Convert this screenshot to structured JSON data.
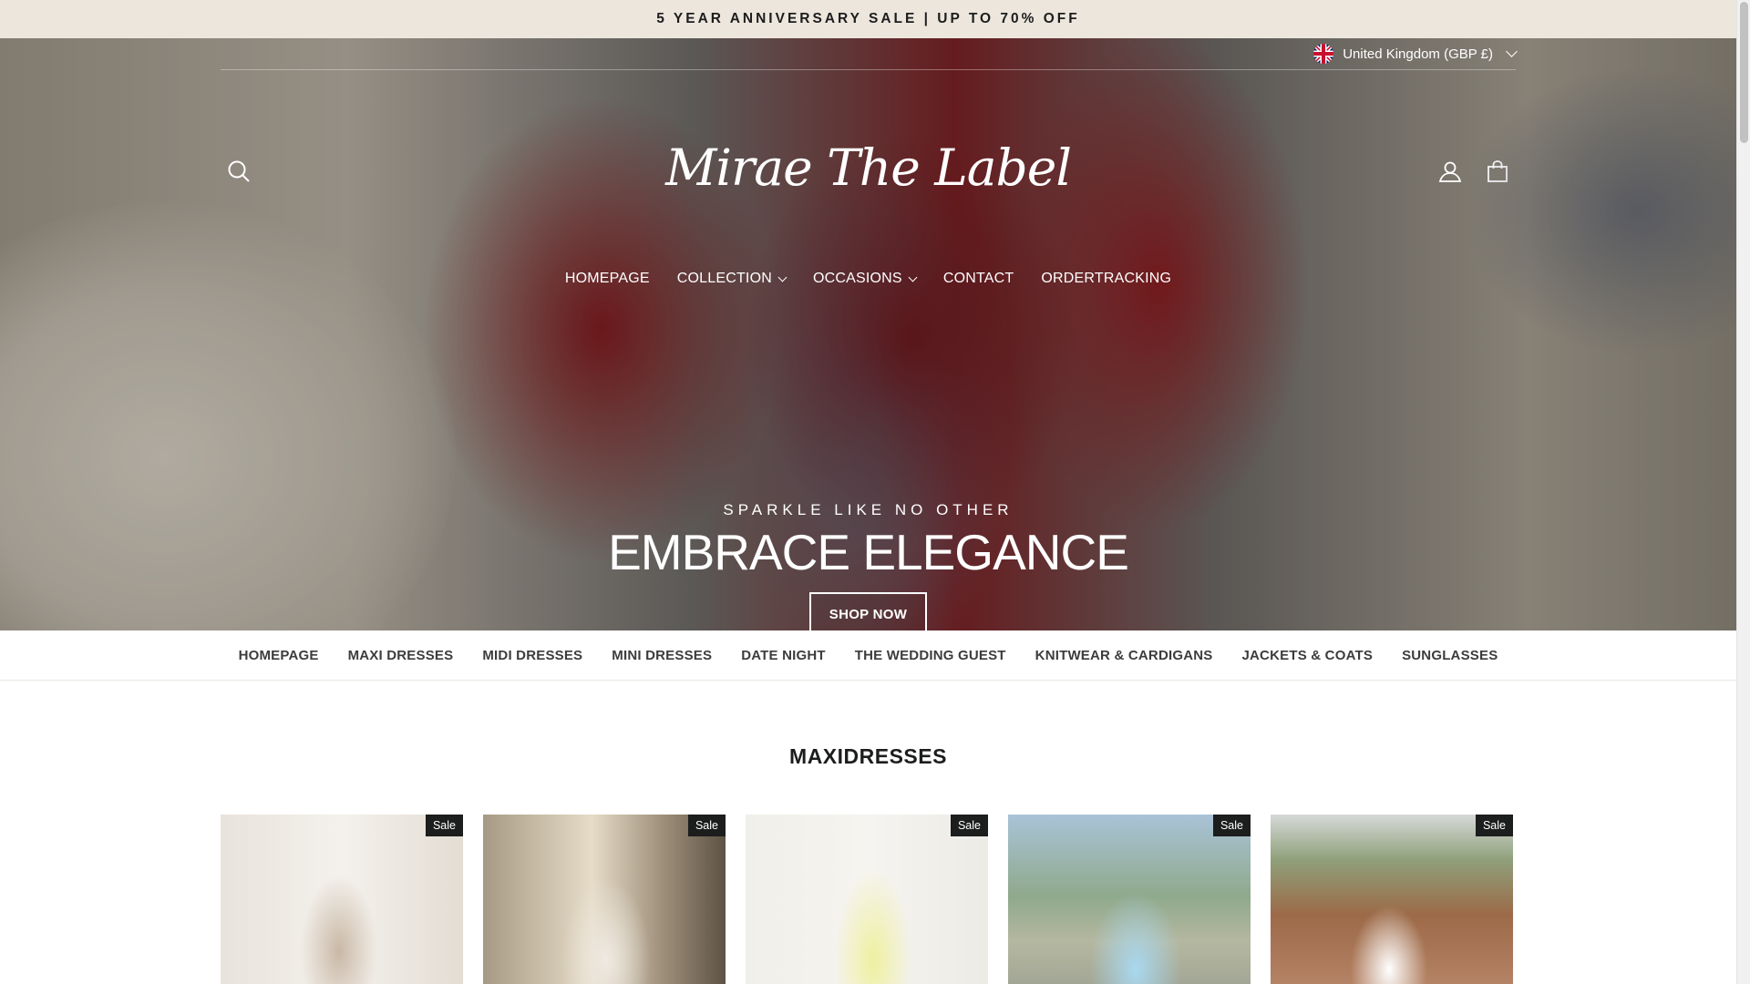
{
  "announcement": {
    "text": "5 YEAR ANNIVERSARY SALE | UP TO 70% OFF"
  },
  "header": {
    "country_selector": "United Kingdom (GBP £)",
    "logo_text": "Mirae The Label",
    "icons": {
      "search": "search-icon",
      "account": "user-icon",
      "cart": "bag-icon",
      "flag": "uk-flag-icon"
    }
  },
  "main_nav": [
    {
      "label": "HOMEPAGE",
      "dropdown": false
    },
    {
      "label": "COLLECTION",
      "dropdown": true
    },
    {
      "label": "OCCASIONS",
      "dropdown": true
    },
    {
      "label": "CONTACT",
      "dropdown": false
    },
    {
      "label": "ORDERTRACKING",
      "dropdown": false
    }
  ],
  "hero": {
    "kicker": "SPARKLE LIKE NO OTHER",
    "headline": "EMBRACE ELEGANCE",
    "cta": "SHOP NOW"
  },
  "category_nav": [
    "HOMEPAGE",
    "MAXI DRESSES",
    "MIDI DRESSES",
    "MINI DRESSES",
    "DATE NIGHT",
    "THE WEDDING GUEST",
    "KNITWEAR & CARDIGANS",
    "JACKETS & COATS",
    "SUNGLASSES"
  ],
  "section": {
    "title": "MAXIDRESSES"
  },
  "products": [
    {
      "badge": "Sale"
    },
    {
      "badge": "Sale"
    },
    {
      "badge": "Sale"
    },
    {
      "badge": "Sale"
    },
    {
      "badge": "Sale"
    }
  ],
  "colors": {
    "announcement_bg": "#ede6dd",
    "text": "#1c1d1d",
    "badge_bg": "#1c1d1d"
  }
}
